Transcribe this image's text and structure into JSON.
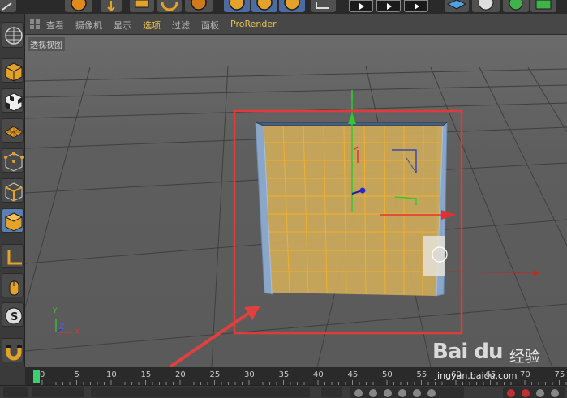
{
  "menubar": {
    "items": [
      {
        "label": "查看"
      },
      {
        "label": "摄像机"
      },
      {
        "label": "显示"
      },
      {
        "label": "选项",
        "active": true
      },
      {
        "label": "过滤"
      },
      {
        "label": "面板"
      },
      {
        "label": "ProRender"
      }
    ]
  },
  "viewport": {
    "label": "透视视图"
  },
  "axis_gizmo": {
    "y": "Y",
    "z": "Z",
    "x": "X"
  },
  "timeline": {
    "start_frame": "0",
    "current_frame": 0,
    "ticks": [
      "0",
      "5",
      "10",
      "15",
      "20",
      "25",
      "30",
      "35",
      "40",
      "45",
      "50",
      "55",
      "60",
      "65",
      "70",
      "75"
    ]
  },
  "watermark": {
    "brand": "Bai du",
    "cn": "经验",
    "url": "jingyan.baidu.com"
  },
  "colors": {
    "accent_active_menu": "#e8c34e",
    "selection_box": "#e03b3b",
    "mesh_fill": "#c9a85a",
    "mesh_wire": "#f0b030",
    "axis_x": "#e03232",
    "axis_y": "#32c832",
    "axis_z": "#3232c8",
    "timeline_marker": "#3ad070"
  }
}
